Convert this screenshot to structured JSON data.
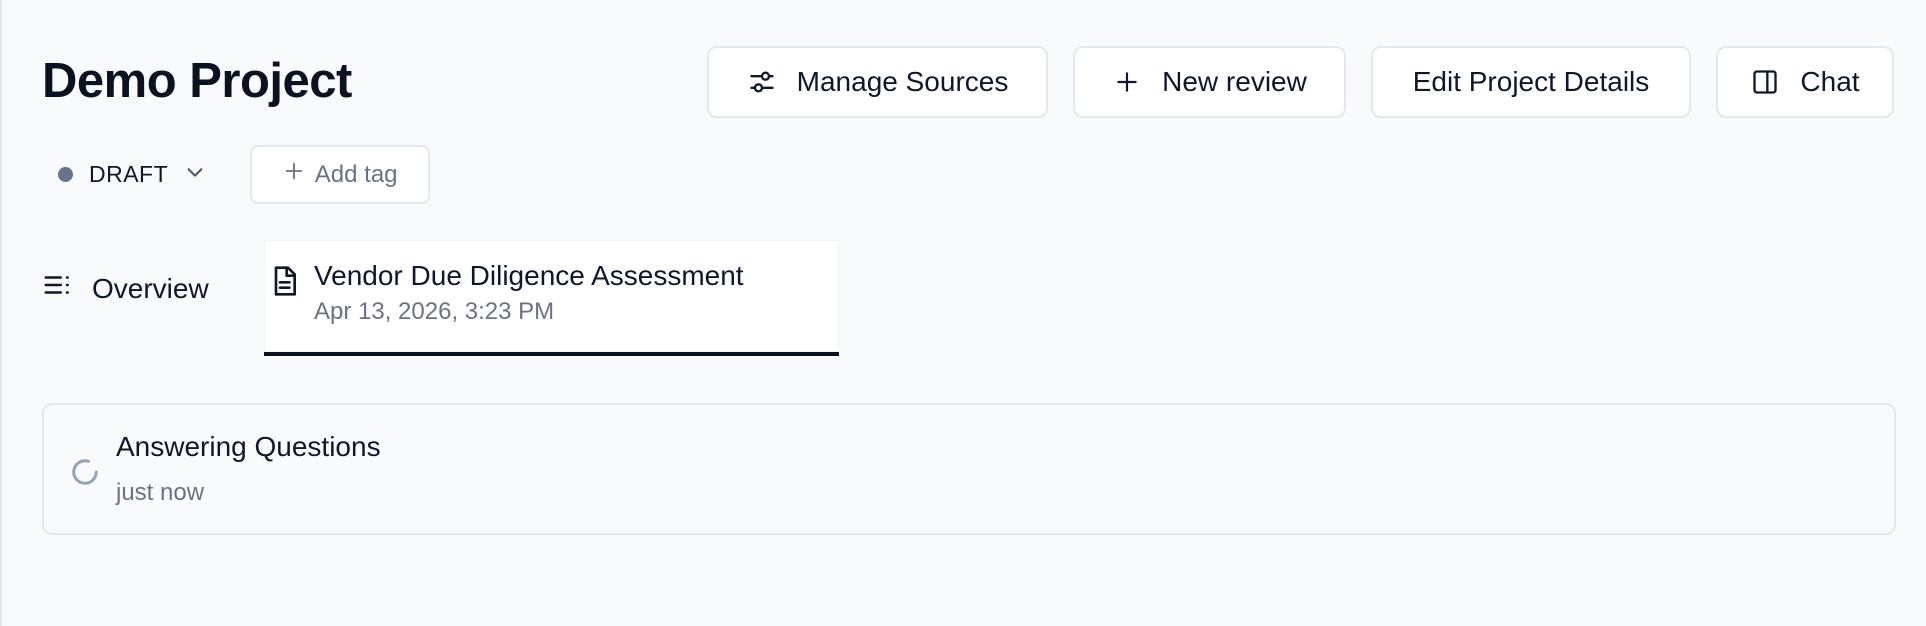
{
  "project": {
    "title": "Demo Project"
  },
  "toolbar": {
    "manage_sources_label": "Manage Sources",
    "new_review_label": "New review",
    "edit_project_label": "Edit Project Details",
    "chat_label": "Chat"
  },
  "status": {
    "label": "DRAFT",
    "dot_color": "#64748b",
    "icon": "chevron-down-icon"
  },
  "tags": {
    "add_tag_label": "Add tag",
    "icon": "plus-icon"
  },
  "tabs": {
    "overview": {
      "label": "Overview",
      "icon": "list-icon"
    },
    "review": {
      "title": "Vendor Due Diligence Assessment",
      "date": "Apr 13, 2026, 3:23 PM",
      "icon": "document-icon",
      "selected": true
    }
  },
  "activity": {
    "title": "Answering Questions",
    "time": "just now",
    "icon": "spinner-icon"
  }
}
